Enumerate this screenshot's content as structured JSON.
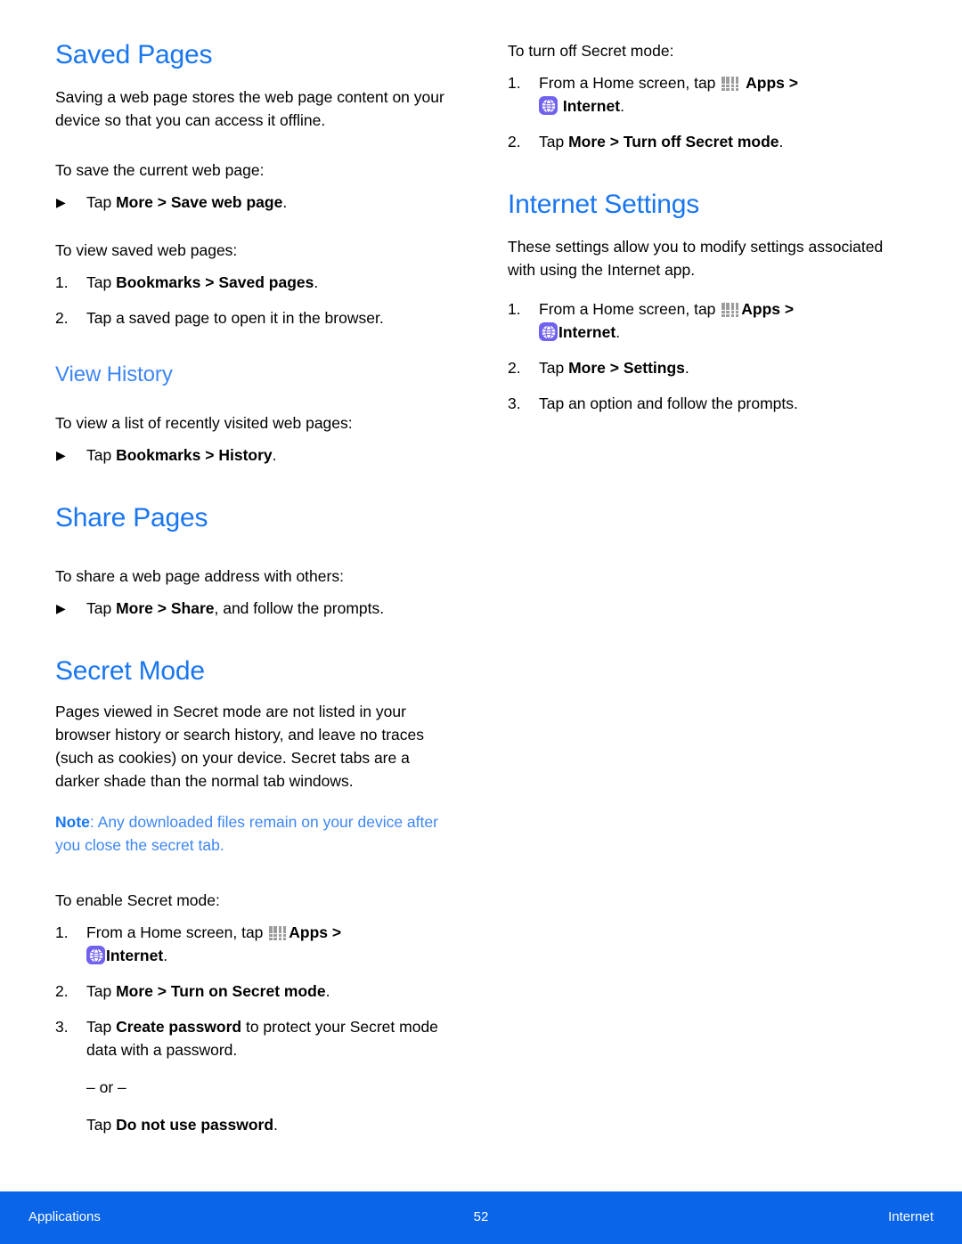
{
  "document": {
    "type": "user-manual-page",
    "accent_heading_color": "#1976F0",
    "sub_heading_color": "#3D86F5",
    "footer_bar_color": "#0A65E8",
    "internet_icon_color": "#7161EF",
    "apps_icon_dot_color": "#9C9C9C"
  },
  "icons": {
    "apps": "apps-grid-icon",
    "internet": "internet-globe-icon",
    "bullet": "▶"
  },
  "left_column": {
    "saved_pages": {
      "heading": "Saved Pages",
      "intro": "Saving a web page stores the web page content on your device so that you can access it offline.",
      "lead_save": "To save the current web page:",
      "bullet_save": {
        "marker": "▶",
        "pre": "Tap ",
        "bold1": "More",
        "mid": " > ",
        "bold2": "Save web page",
        "post": "."
      },
      "lead_view": "To view saved web pages:",
      "steps_view": [
        {
          "marker": "1.",
          "pre": "Tap ",
          "bold1": "Bookmarks",
          "mid": " > ",
          "bold2": "Saved pages",
          "post": "."
        },
        {
          "marker": "2.",
          "pre": "Tap a saved page to open it in the browser.",
          "bold1": "",
          "mid": "",
          "bold2": "",
          "post": ""
        }
      ]
    },
    "view_history": {
      "heading": "View History",
      "lead": "To view a list of recently visited web pages:",
      "bullet": {
        "marker": "▶",
        "pre": "Tap ",
        "bold1": "Bookmarks",
        "mid": " > ",
        "bold2": "History",
        "post": "."
      }
    },
    "share_pages": {
      "heading": "Share Pages",
      "lead": "To share a web page address with others:",
      "bullet": {
        "marker": "▶",
        "pre": "Tap ",
        "bold1": "More",
        "mid": " > ",
        "bold2": "Share",
        "post": ", and follow the prompts."
      }
    },
    "secret_mode": {
      "heading": "Secret Mode",
      "intro": "Pages viewed in Secret mode are not listed in your browser history or search history, and leave no traces (such as cookies) on your device. Secret tabs are a darker shade than the normal tab windows.",
      "note_label": "Note",
      "note_text": ": Any downloaded files remain on your device after you close the secret tab.",
      "lead": "To enable Secret mode:",
      "step1": {
        "marker": "1.",
        "pre": "From a Home screen, tap ",
        "apps_label": "Apps",
        "sep": " > ",
        "internet_label": "Internet",
        "post": "."
      },
      "step2": {
        "marker": "2.",
        "pre": "Tap ",
        "bold1": "More",
        "mid": " > ",
        "bold2": "Turn on Secret mode",
        "post": "."
      },
      "step3": {
        "marker": "3.",
        "pre": "Tap ",
        "bold1": "Create password",
        "post": " to protect your Secret mode data with a password."
      },
      "or_text": "– or –",
      "alt": {
        "pre": "Tap ",
        "bold1": "Do not use password",
        "post": "."
      }
    }
  },
  "right_column": {
    "turn_off_secret": {
      "lead": "To turn off Secret mode:",
      "step1": {
        "marker": "1.",
        "pre": "From a Home screen, tap ",
        "apps_label": "Apps",
        "sep": " > ",
        "internet_label": "Internet",
        "post": "."
      },
      "step2": {
        "marker": "2.",
        "pre": "Tap ",
        "bold1": "More",
        "mid": " > ",
        "bold2": "Turn off Secret mode",
        "post": "."
      }
    },
    "internet_settings": {
      "heading": "Internet Settings",
      "intro": "These settings allow you to modify settings associated with using the Internet app.",
      "step1": {
        "marker": "1.",
        "pre": "From a Home screen, tap ",
        "apps_label": "Apps",
        "sep": " > ",
        "internet_label": "Internet",
        "post": "."
      },
      "step2": {
        "marker": "2.",
        "pre": "Tap ",
        "bold1": "More",
        "mid": " > ",
        "bold2": "Settings",
        "post": "."
      },
      "step3": {
        "marker": "3.",
        "pre": "Tap an option and follow the prompts.",
        "bold1": "",
        "mid": "",
        "bold2": "",
        "post": ""
      }
    }
  },
  "footer": {
    "left": "Applications",
    "page_number": "52",
    "right": "Internet"
  }
}
